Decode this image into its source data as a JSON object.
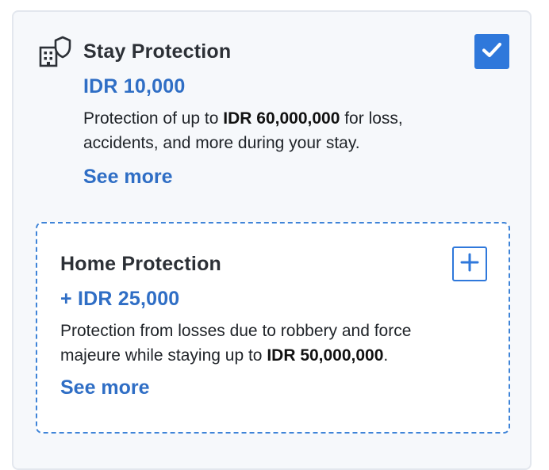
{
  "stay_protection": {
    "icon": "hotel-shield-icon",
    "title": "Stay Protection",
    "price": "IDR 10,000",
    "desc_prefix": "Protection of up to ",
    "desc_amount": "IDR 60,000,000",
    "desc_suffix": " for loss, accidents, and more during your stay.",
    "see_more": "See more",
    "checked": true
  },
  "home_protection": {
    "title": "Home Protection",
    "price": "+ IDR 25,000",
    "desc_prefix": "Protection from losses due to robbery and force majeure while staying up to ",
    "desc_amount": "IDR 50,000,000",
    "desc_suffix": ".",
    "see_more": "See more",
    "add_icon": "plus-icon"
  },
  "colors": {
    "accent_blue": "#2f78db",
    "price_blue": "#2f6ec5",
    "card_bg": "#f6f8fb"
  }
}
